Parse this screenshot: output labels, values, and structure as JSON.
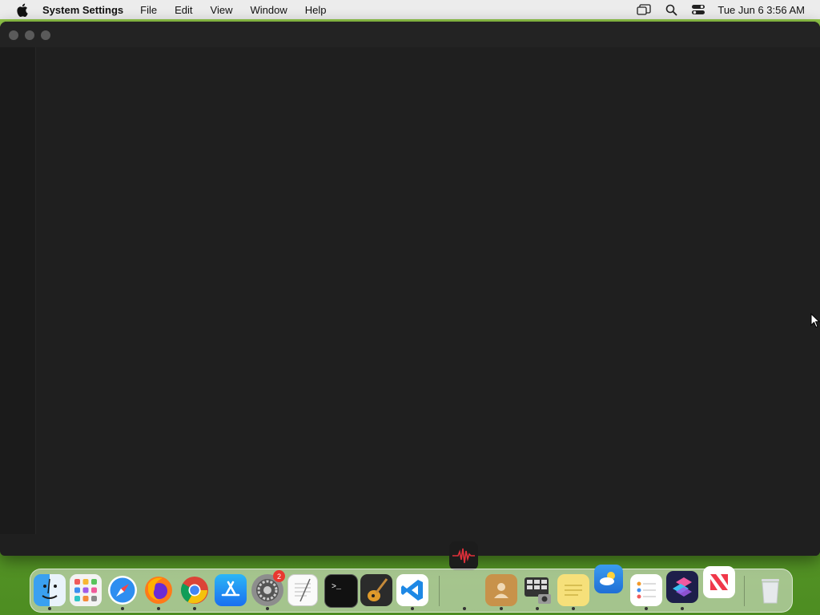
{
  "menubar": {
    "app_name": "System Settings",
    "menus": [
      "File",
      "Edit",
      "View",
      "Window",
      "Help"
    ],
    "clock": "Tue Jun 6  3:56 AM"
  },
  "window": {
    "controls": [
      "close",
      "minimize",
      "zoom"
    ]
  },
  "dock": {
    "apps": [
      {
        "name": "Finder",
        "icon": "finder-icon",
        "running": true
      },
      {
        "name": "Launchpad",
        "icon": "launchpad-icon",
        "running": false
      },
      {
        "name": "Safari",
        "icon": "safari-icon",
        "running": true
      },
      {
        "name": "Firefox",
        "icon": "firefox-icon",
        "running": true
      },
      {
        "name": "Chrome",
        "icon": "chrome-icon",
        "running": true
      },
      {
        "name": "App Store",
        "icon": "app-store-icon",
        "running": false
      },
      {
        "name": "System Settings",
        "icon": "system-settings-icon",
        "running": true,
        "badge": "2"
      },
      {
        "name": "TextEdit",
        "icon": "textedit-icon",
        "running": false
      },
      {
        "name": "Terminal",
        "icon": "terminal-icon",
        "running": false
      },
      {
        "name": "GarageBand",
        "icon": "garageband-icon",
        "running": false
      },
      {
        "name": "Visual Studio Code",
        "icon": "vscode-icon",
        "running": true
      },
      {
        "name": "Audio App",
        "icon": "audio-waveform-icon",
        "running": true
      },
      {
        "name": "Contacts",
        "icon": "contacts-icon",
        "running": true
      },
      {
        "name": "Image Capture",
        "icon": "image-capture-icon",
        "running": true
      },
      {
        "name": "Stickies",
        "icon": "stickies-icon",
        "running": true
      },
      {
        "name": "Weather",
        "icon": "weather-icon",
        "running": false
      },
      {
        "name": "Reminders",
        "icon": "reminders-icon",
        "running": true
      },
      {
        "name": "Shortcuts",
        "icon": "shortcuts-icon",
        "running": true
      },
      {
        "name": "News",
        "icon": "news-icon",
        "running": false
      },
      {
        "name": "Trash",
        "icon": "trash-icon",
        "running": false
      }
    ],
    "badge_count": "2"
  },
  "colors": {
    "window_bg": "#1f1f1f",
    "menubar_bg": "#ececec",
    "badge_red": "#e8382f"
  }
}
